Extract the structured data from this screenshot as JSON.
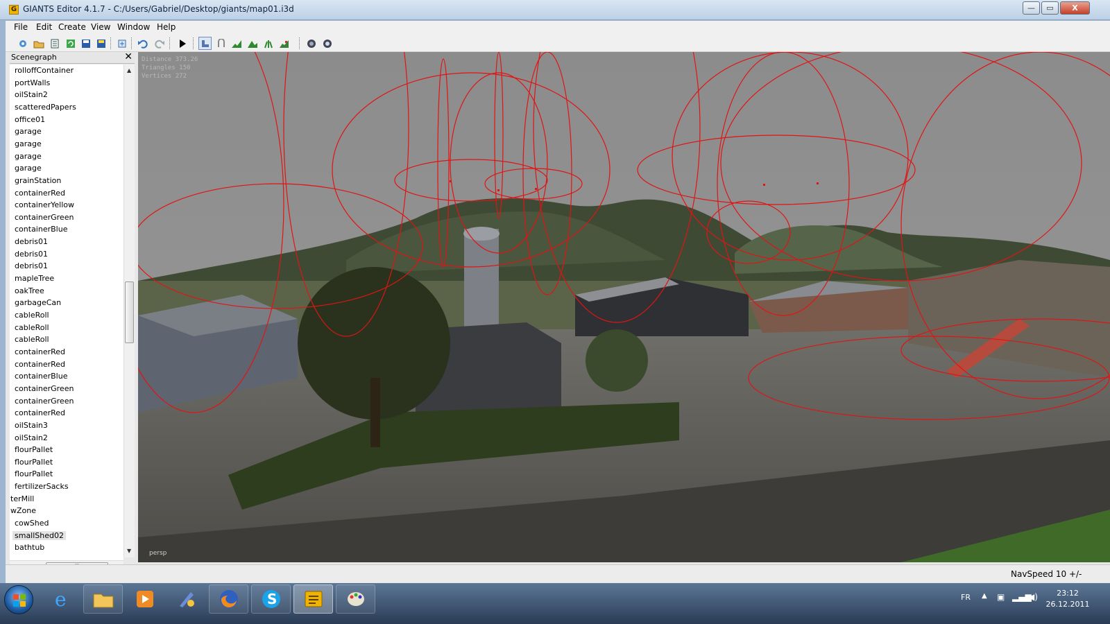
{
  "window": {
    "title": "GIANTS Editor 4.1.7 - C:/Users/Gabriel/Desktop/giants/map01.i3d",
    "minimize": "—",
    "maximize": "▭",
    "close": "X"
  },
  "menu": [
    {
      "label": "File"
    },
    {
      "label": "Edit"
    },
    {
      "label": "Create"
    },
    {
      "label": "View"
    },
    {
      "label": "Window"
    },
    {
      "label": "Help"
    }
  ],
  "toolbar_icons": [
    "new-icon",
    "open-icon",
    "list-icon",
    "refresh-icon",
    "save-icon",
    "save-all-icon",
    "import-icon",
    "undo-icon",
    "redo-icon",
    "play-icon",
    "select-icon",
    "move-icon",
    "terrain-raise-icon",
    "terrain-smooth-icon",
    "foliage-paint-icon",
    "terrain-paint-icon",
    "settings-gear-icon",
    "view-gear-icon"
  ],
  "scenegraph": {
    "title": "Scenegraph",
    "close": "✕",
    "items": [
      "rolloffContainer",
      "portWalls",
      "oilStain2",
      "scatteredPapers",
      "office01",
      "garage",
      "garage",
      "garage",
      "garage",
      "grainStation",
      "containerRed",
      "containerYellow",
      "containerGreen",
      "containerBlue",
      "debris01",
      "debris01",
      "debris01",
      "mapleTree",
      "oakTree",
      "garbageCan",
      "cableRoll",
      "cableRoll",
      "cableRoll",
      "containerRed",
      "containerRed",
      "containerBlue",
      "containerGreen",
      "containerGreen",
      "containerRed",
      "oilStain3",
      "oilStain2",
      "flourPallet",
      "flourPallet",
      "flourPallet",
      "fertilizerSacks",
      "terMill",
      "wZone",
      "cowShed",
      "smallShed02",
      "bathtub"
    ],
    "hscroll_grip": "III"
  },
  "viewport": {
    "distance": "Distance 373.26",
    "triangles": "Triangles 150",
    "vertices": "Vertices 272",
    "camera": "persp"
  },
  "status": {
    "navspeed": "NavSpeed 10 +/-"
  },
  "taskbar": {
    "apps": [
      {
        "icon": "internet-explorer-icon",
        "state": "normal"
      },
      {
        "icon": "explorer-folder-icon",
        "state": "pinned"
      },
      {
        "icon": "media-player-icon",
        "state": "normal"
      },
      {
        "icon": "paint-tool-icon",
        "state": "normal"
      },
      {
        "icon": "firefox-icon",
        "state": "pinned"
      },
      {
        "icon": "skype-icon",
        "state": "pinned"
      },
      {
        "icon": "giants-editor-icon",
        "state": "active"
      },
      {
        "icon": "paint-palette-icon",
        "state": "pinned"
      }
    ],
    "lang": "FR",
    "time": "23:12",
    "date": "26.12.2011"
  }
}
